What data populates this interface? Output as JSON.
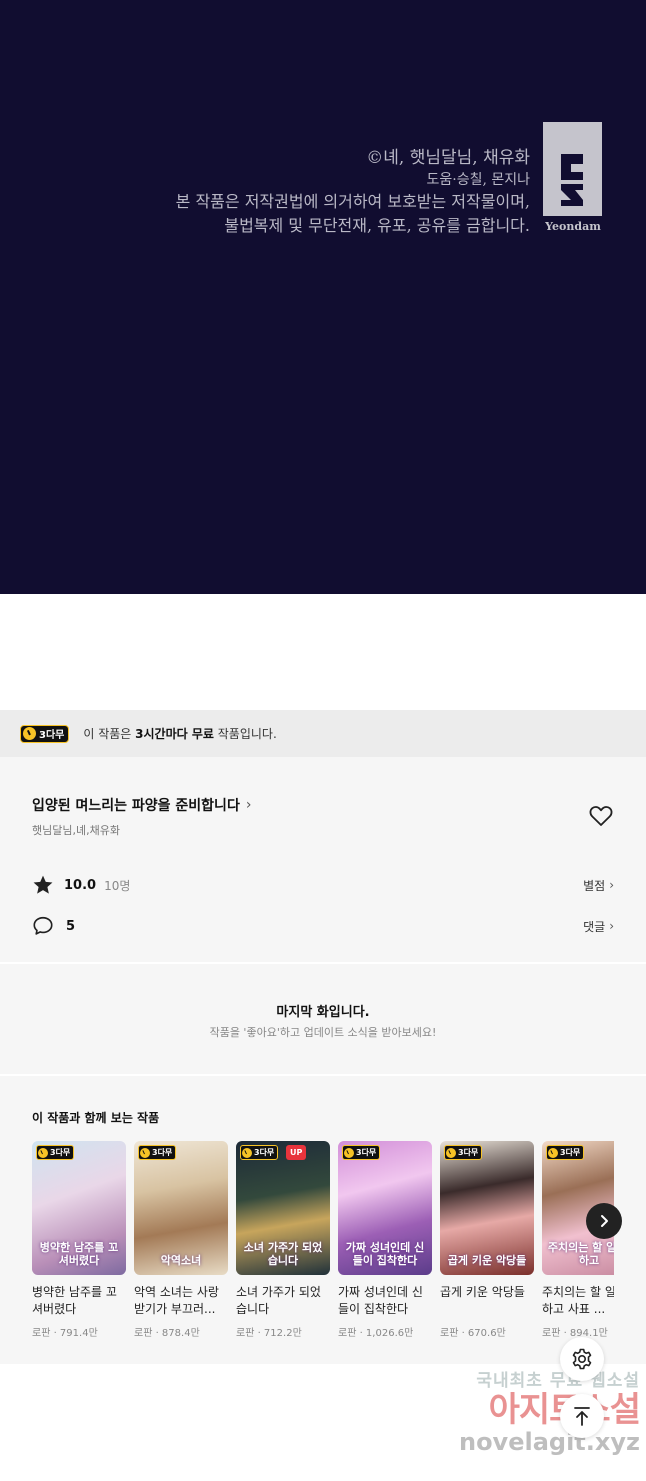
{
  "comic_panel": {
    "copyright_line1": "©녜, 햇님달님, 채유화",
    "copyright_line2": "도움·승칠, 몬지나",
    "copyright_line3": "본 작품은 저작권법에 의거하여 보호받는 저작물이며,",
    "copyright_line4": "불법복제 및 무단전재, 유포, 공유를 금합니다.",
    "logo_text": "Yeondam",
    "background": "#110d30"
  },
  "free_banner": {
    "badge_label": "3다무",
    "text_prefix": "이 작품은 ",
    "text_bold": "3시간마다 무료",
    "text_suffix": " 작품입니다."
  },
  "work": {
    "title": "입양된 며느리는 파양을 준비합니다",
    "authors": "햇님달님,녜,채유화",
    "rating": "10.0",
    "rating_count": "10명",
    "rating_link": "별점",
    "comment_count": "5",
    "comment_link": "댓글"
  },
  "last_episode": {
    "title": "마지막 화입니다.",
    "subtitle": "작품을 '좋아요'하고 업데이트 소식을 받아보세요!"
  },
  "recommend": {
    "heading": "이 작품과 함께 보는 작품",
    "items": [
      {
        "title": "병약한 남주를 꼬셔버렸다",
        "meta": "로판 · 791.4만",
        "badge": "3다무",
        "cover_text": "병약한 남주를 꼬셔버렸다",
        "up": ""
      },
      {
        "title": "악역 소녀는 사랑받기가 부끄러...",
        "meta": "로판 · 878.4만",
        "badge": "3다무",
        "cover_text": "악역소녀",
        "up": ""
      },
      {
        "title": "소녀 가주가 되었습니다",
        "meta": "로판 · 712.2만",
        "badge": "3다무",
        "cover_text": "소녀 가주가 되었습니다",
        "up": "UP"
      },
      {
        "title": "가짜 성녀인데 신들이 집착한다",
        "meta": "로판 · 1,026.6만",
        "badge": "3다무",
        "cover_text": "가짜 성녀인데 신들이 집착한다",
        "up": ""
      },
      {
        "title": "곱게 키운 악당들",
        "meta": "로판 · 670.6만",
        "badge": "3다무",
        "cover_text": "곱게 키운 악당들",
        "up": ""
      },
      {
        "title": "주치의는 할 일 다 하고 사표 ...",
        "meta": "로판 · 894.1만",
        "badge": "3다무",
        "cover_text": "주치의는 할 일 다 하고",
        "up": ""
      }
    ]
  },
  "watermark": {
    "line1": "국내최초 무료 웹소설",
    "line2": "아지트소설",
    "line3": "novelagit.xyz"
  },
  "colors": {
    "badge_yellow": "#f7c326",
    "up_red": "#e8343c"
  }
}
